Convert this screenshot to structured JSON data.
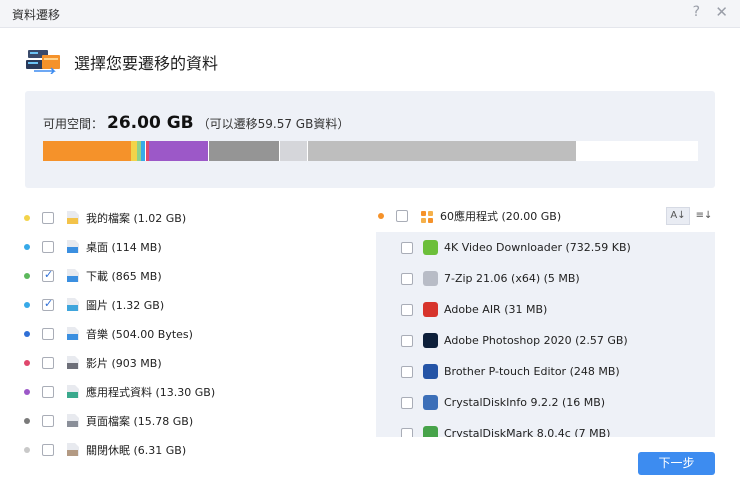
{
  "window": {
    "title": "資料遷移",
    "help_glyph": "?",
    "close_glyph": "✕"
  },
  "header": {
    "title": "選擇您要遷移的資料"
  },
  "space": {
    "label": "可用空間：",
    "value": "26.00 GB",
    "note": "（可以遷移59.57 GB資料）",
    "segments": [
      {
        "color": "#f5922a",
        "fraction": 0.135
      },
      {
        "color": "#f3d34a",
        "fraction": 0.008
      },
      {
        "color": "#8fd18a",
        "fraction": 0.006
      },
      {
        "color": "#37a9e8",
        "fraction": 0.006
      },
      {
        "color": "#ffffff",
        "fraction": 0.003
      },
      {
        "color": "#e0476c",
        "fraction": 0.004
      },
      {
        "color": "#9c58c8",
        "fraction": 0.09
      },
      {
        "color": "#ffffff",
        "fraction": 0.002
      },
      {
        "color": "#959595",
        "fraction": 0.106
      },
      {
        "color": "#ffffff",
        "fraction": 0.002
      },
      {
        "color": "#d5d6da",
        "fraction": 0.041
      },
      {
        "color": "#ffffff",
        "fraction": 0.001
      },
      {
        "color": "#bebebe",
        "fraction": 0.41
      },
      {
        "color": "#ffffff",
        "fraction": 0.186
      }
    ]
  },
  "folders": [
    {
      "label": "我的檔案 (1.02 GB)",
      "dot": "#f3d34a",
      "checked": false,
      "icon": "document-folder-icon",
      "icolor": "#f3c34a"
    },
    {
      "label": "桌面 (114 MB)",
      "dot": "#37a9e8",
      "checked": false,
      "icon": "desktop-folder-icon",
      "icolor": "#3b8fe0"
    },
    {
      "label": "下載 (865 MB)",
      "dot": "#5cb85c",
      "checked": true,
      "icon": "downloads-folder-icon",
      "icolor": "#3b8fe0"
    },
    {
      "label": "圖片 (1.32 GB)",
      "dot": "#37a9e8",
      "checked": true,
      "icon": "pictures-folder-icon",
      "icolor": "#3fa5dc"
    },
    {
      "label": "音樂 (504.00 Bytes)",
      "dot": "#2f6fd6",
      "checked": false,
      "icon": "music-folder-icon",
      "icolor": "#3b8fe0"
    },
    {
      "label": "影片 (903 MB)",
      "dot": "#e0476c",
      "checked": false,
      "icon": "video-folder-icon",
      "icolor": "#6d6f79"
    },
    {
      "label": "應用程式資料 (13.30 GB)",
      "dot": "#9c58c8",
      "checked": false,
      "icon": "app-data-icon",
      "icolor": "#3aa98d"
    },
    {
      "label": "頁面檔案 (15.78 GB)",
      "dot": "#7a7a7a",
      "checked": false,
      "icon": "page-file-icon",
      "icolor": "#8a8f99"
    },
    {
      "label": "關閉休眠 (6.31 GB)",
      "dot": "#c9c9c9",
      "checked": false,
      "icon": "hibernate-file-icon",
      "icolor": "#b39a83"
    }
  ],
  "apps_header": {
    "label": "60應用程式 (20.00 GB)",
    "dot": "#f5922a",
    "sort_asc": "A↓",
    "sort_list": "≡↓"
  },
  "apps": [
    {
      "label": "4K Video Downloader (732.59 KB)",
      "icon": "4k-video-downloader-icon",
      "icolor": "#6cbf3a"
    },
    {
      "label": "7-Zip 21.06 (x64) (5 MB)",
      "icon": "7zip-icon",
      "icolor": "#b8bcc6"
    },
    {
      "label": "Adobe AIR (31 MB)",
      "icon": "adobe-air-icon",
      "icolor": "#d7342c"
    },
    {
      "label": "Adobe Photoshop 2020 (2.57 GB)",
      "icon": "photoshop-icon",
      "icolor": "#0d1f3a"
    },
    {
      "label": "Brother P-touch Editor (248 MB)",
      "icon": "ptouch-editor-icon",
      "icolor": "#2454a6"
    },
    {
      "label": "CrystalDiskInfo 9.2.2 (16 MB)",
      "icon": "crystaldiskinfo-icon",
      "icolor": "#3c6fb8"
    },
    {
      "label": "CrystalDiskMark 8.0.4c (7 MB)",
      "icon": "crystaldiskmark-icon",
      "icolor": "#47a34a"
    }
  ],
  "footer": {
    "next_label": "下一步"
  }
}
